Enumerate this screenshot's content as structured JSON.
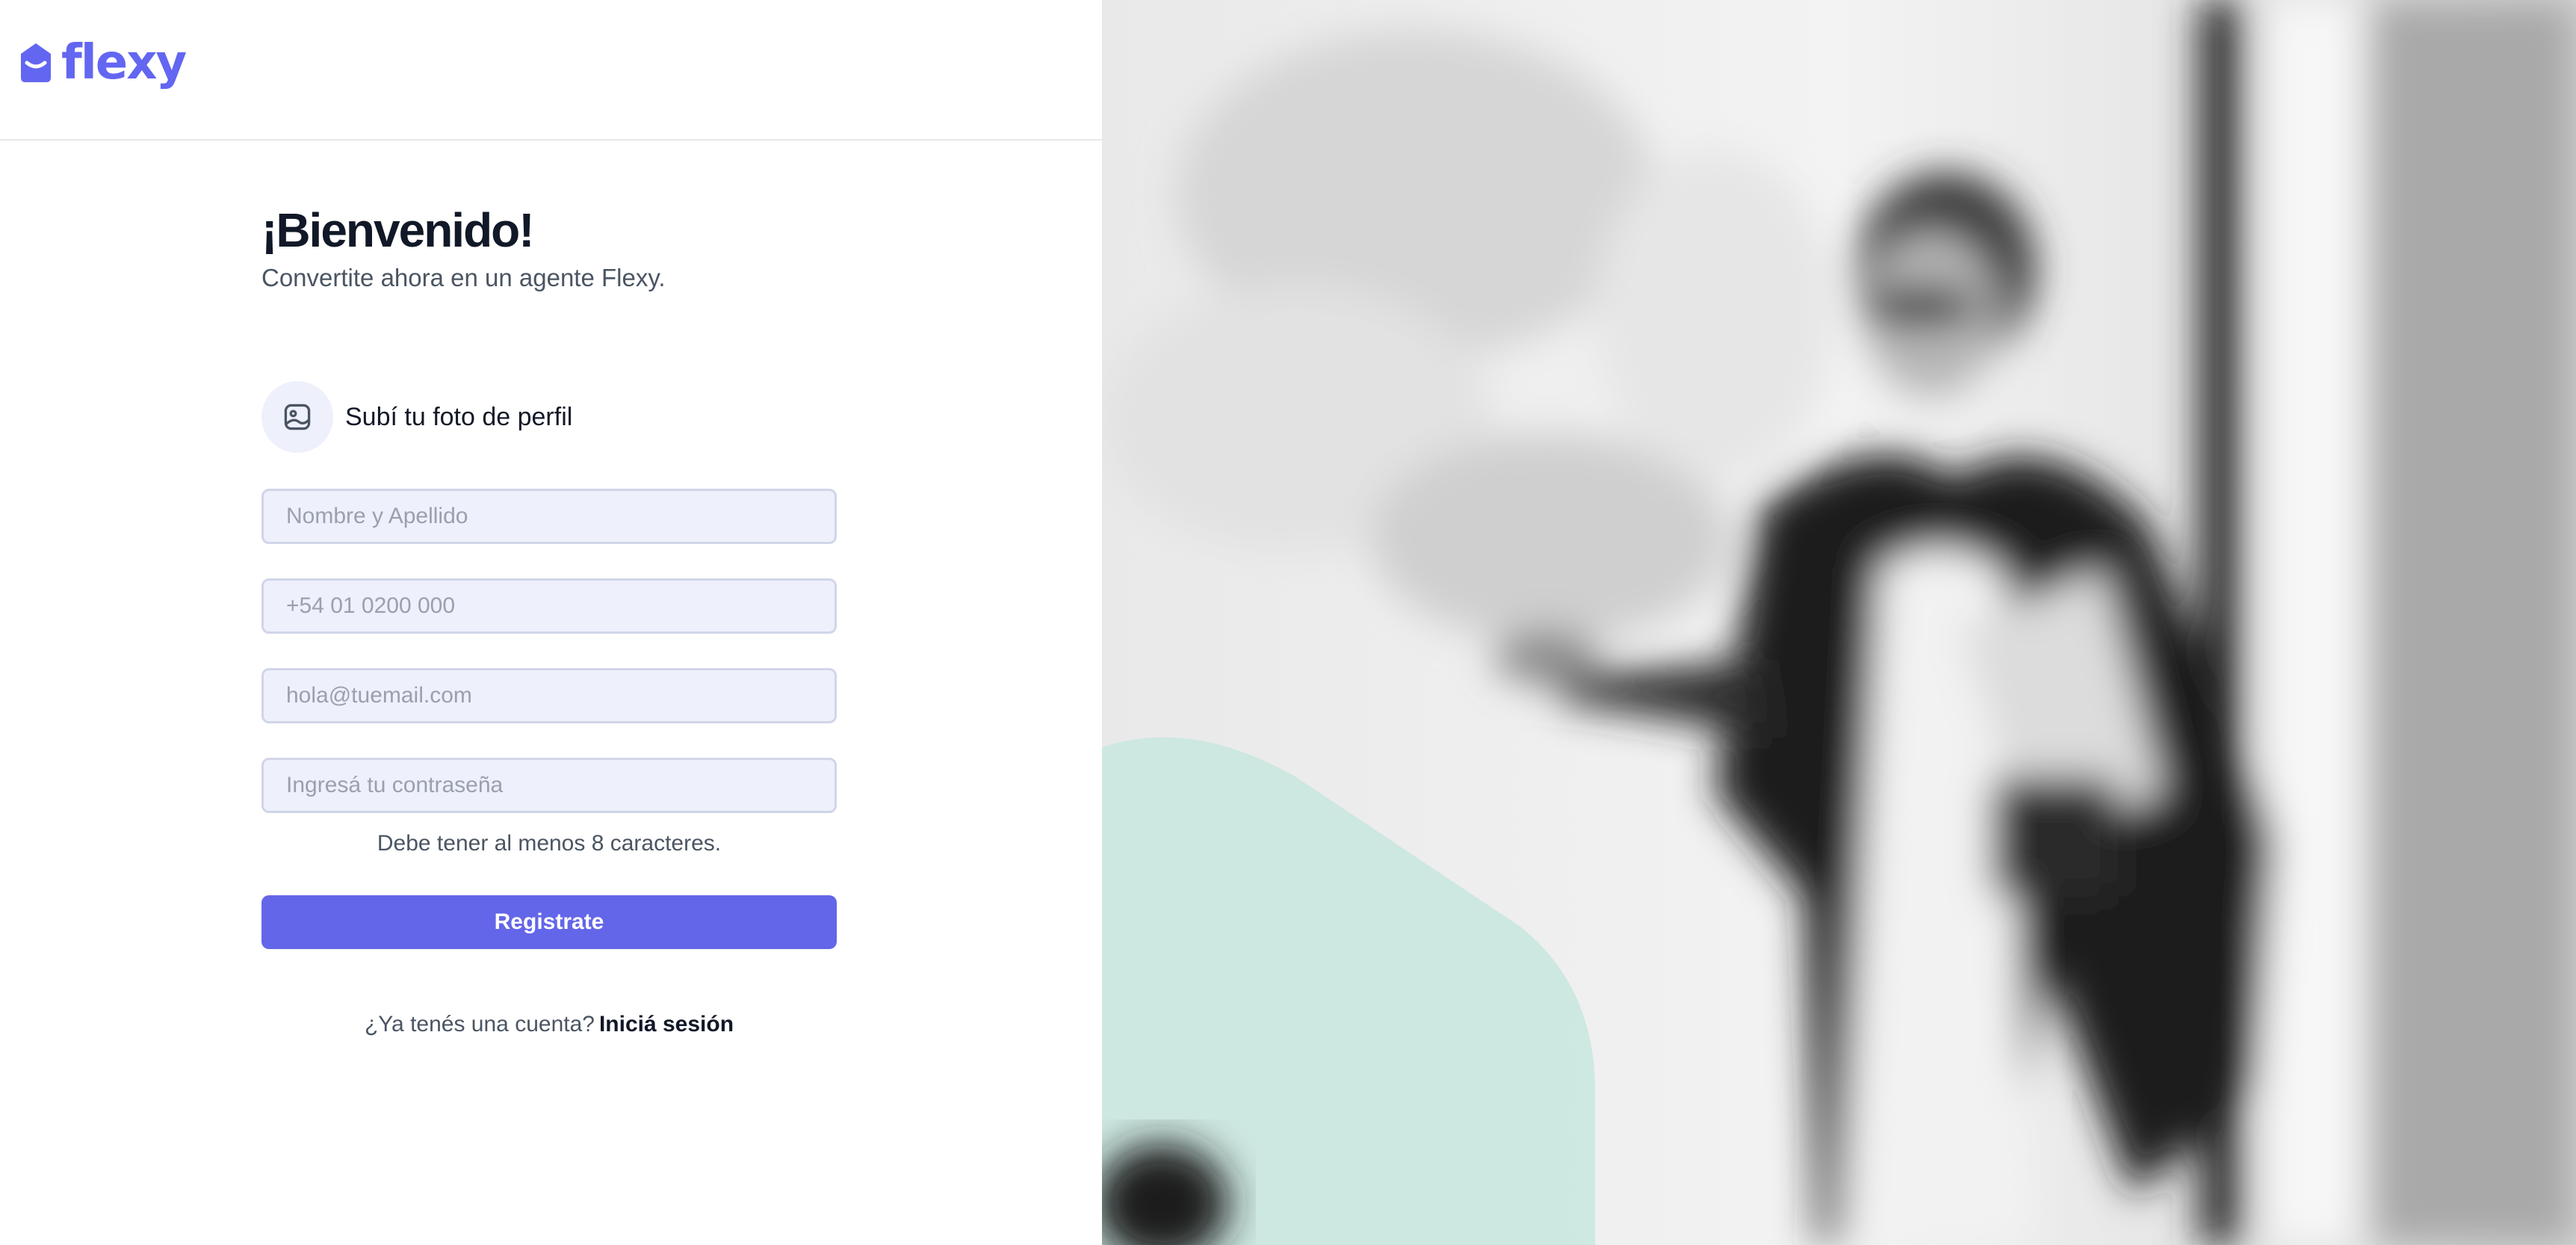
{
  "brand": {
    "name": "flexy",
    "color": "#6366f1"
  },
  "hero": {
    "title": "¡Bienvenido!",
    "subtitle": "Convertite ahora en un agente Flexy."
  },
  "upload": {
    "label": "Subí tu foto de perfil",
    "icon": "image-upload-icon"
  },
  "form": {
    "name_placeholder": "Nombre y Apellido",
    "phone_placeholder": "+54 01 0200 000",
    "email_placeholder": "hola@tuemail.com",
    "password_placeholder": "Ingresá tu contraseña",
    "password_hint": "Debe tener al menos 8 caracteres.",
    "submit_label": "Registrate"
  },
  "footer": {
    "question": "¿Ya tenés una cuenta?",
    "link_label": "Iniciá sesión"
  },
  "colors": {
    "accent": "#6366e8",
    "teal_shape": "#c8e6df"
  }
}
